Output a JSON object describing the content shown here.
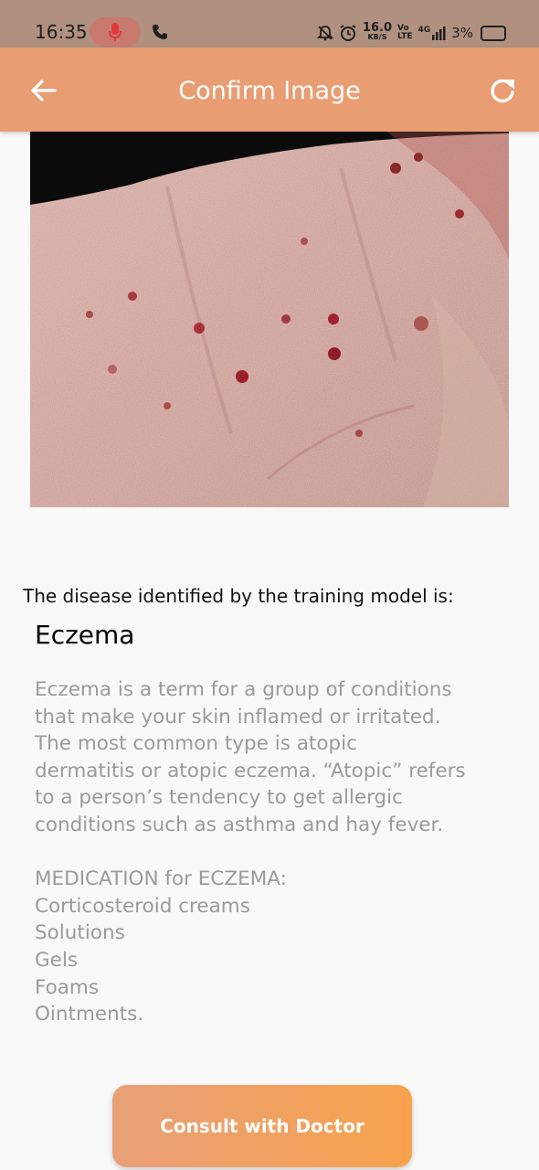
{
  "status_bar": {
    "time": "16:35",
    "net_speed_value": "16.0",
    "net_speed_unit": "KB/S",
    "volte_top": "Vo",
    "volte_bottom": "LTE",
    "network": "4G",
    "battery": "3%"
  },
  "app_bar": {
    "title": "Confirm Image",
    "back_icon": "arrow-left-icon",
    "refresh_icon": "refresh-icon"
  },
  "result": {
    "caption": "The disease identified by the training model is:",
    "disease_name": "Eczema",
    "description_lines": [
      "Eczema is a term for a group of conditions",
      "that make your skin inflamed or irritated.",
      "The most common type is atopic",
      "dermatitis or atopic eczema. “Atopic” refers",
      "to a person’s tendency to get allergic",
      "conditions such as asthma and hay fever."
    ],
    "medication_lines": [
      "MEDICATION for ECZEMA:",
      "Corticosteroid creams",
      "Solutions",
      "Gels",
      "Foams",
      "Ointments."
    ]
  },
  "actions": {
    "consult_label": "Consult with Doctor"
  },
  "colors": {
    "app_bar": "#e89d73",
    "status_bar": "#b0917f",
    "button_start": "#e8a078",
    "button_end": "#f7a24c",
    "description_text": "#9a9a9a"
  }
}
